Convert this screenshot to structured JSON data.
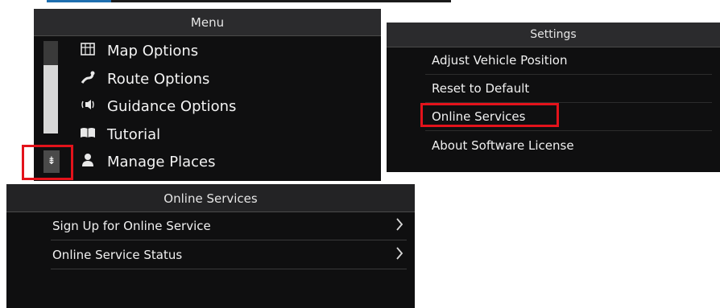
{
  "menu": {
    "title": "Menu",
    "items": [
      {
        "label": "Map Options",
        "icon": "map-icon"
      },
      {
        "label": "Route Options",
        "icon": "route-icon"
      },
      {
        "label": "Guidance Options",
        "icon": "speaker-icon"
      },
      {
        "label": "Tutorial",
        "icon": "book-icon"
      },
      {
        "label": "Manage Places",
        "icon": "person-icon"
      }
    ],
    "scroll_down_glyph": "⇟"
  },
  "settings": {
    "title": "Settings",
    "items": [
      {
        "label": "Adjust Vehicle Position"
      },
      {
        "label": "Reset to Default"
      },
      {
        "label": "Online Services"
      },
      {
        "label": "About Software License"
      }
    ]
  },
  "online_services": {
    "title": "Online Services",
    "items": [
      {
        "label": "Sign Up for Online Service"
      },
      {
        "label": "Online Service Status"
      }
    ]
  },
  "colors": {
    "highlight": "#e3131b",
    "panel": "#0f0f10",
    "header": "#2b2b2d",
    "top_accent": "#1e6fb0"
  }
}
